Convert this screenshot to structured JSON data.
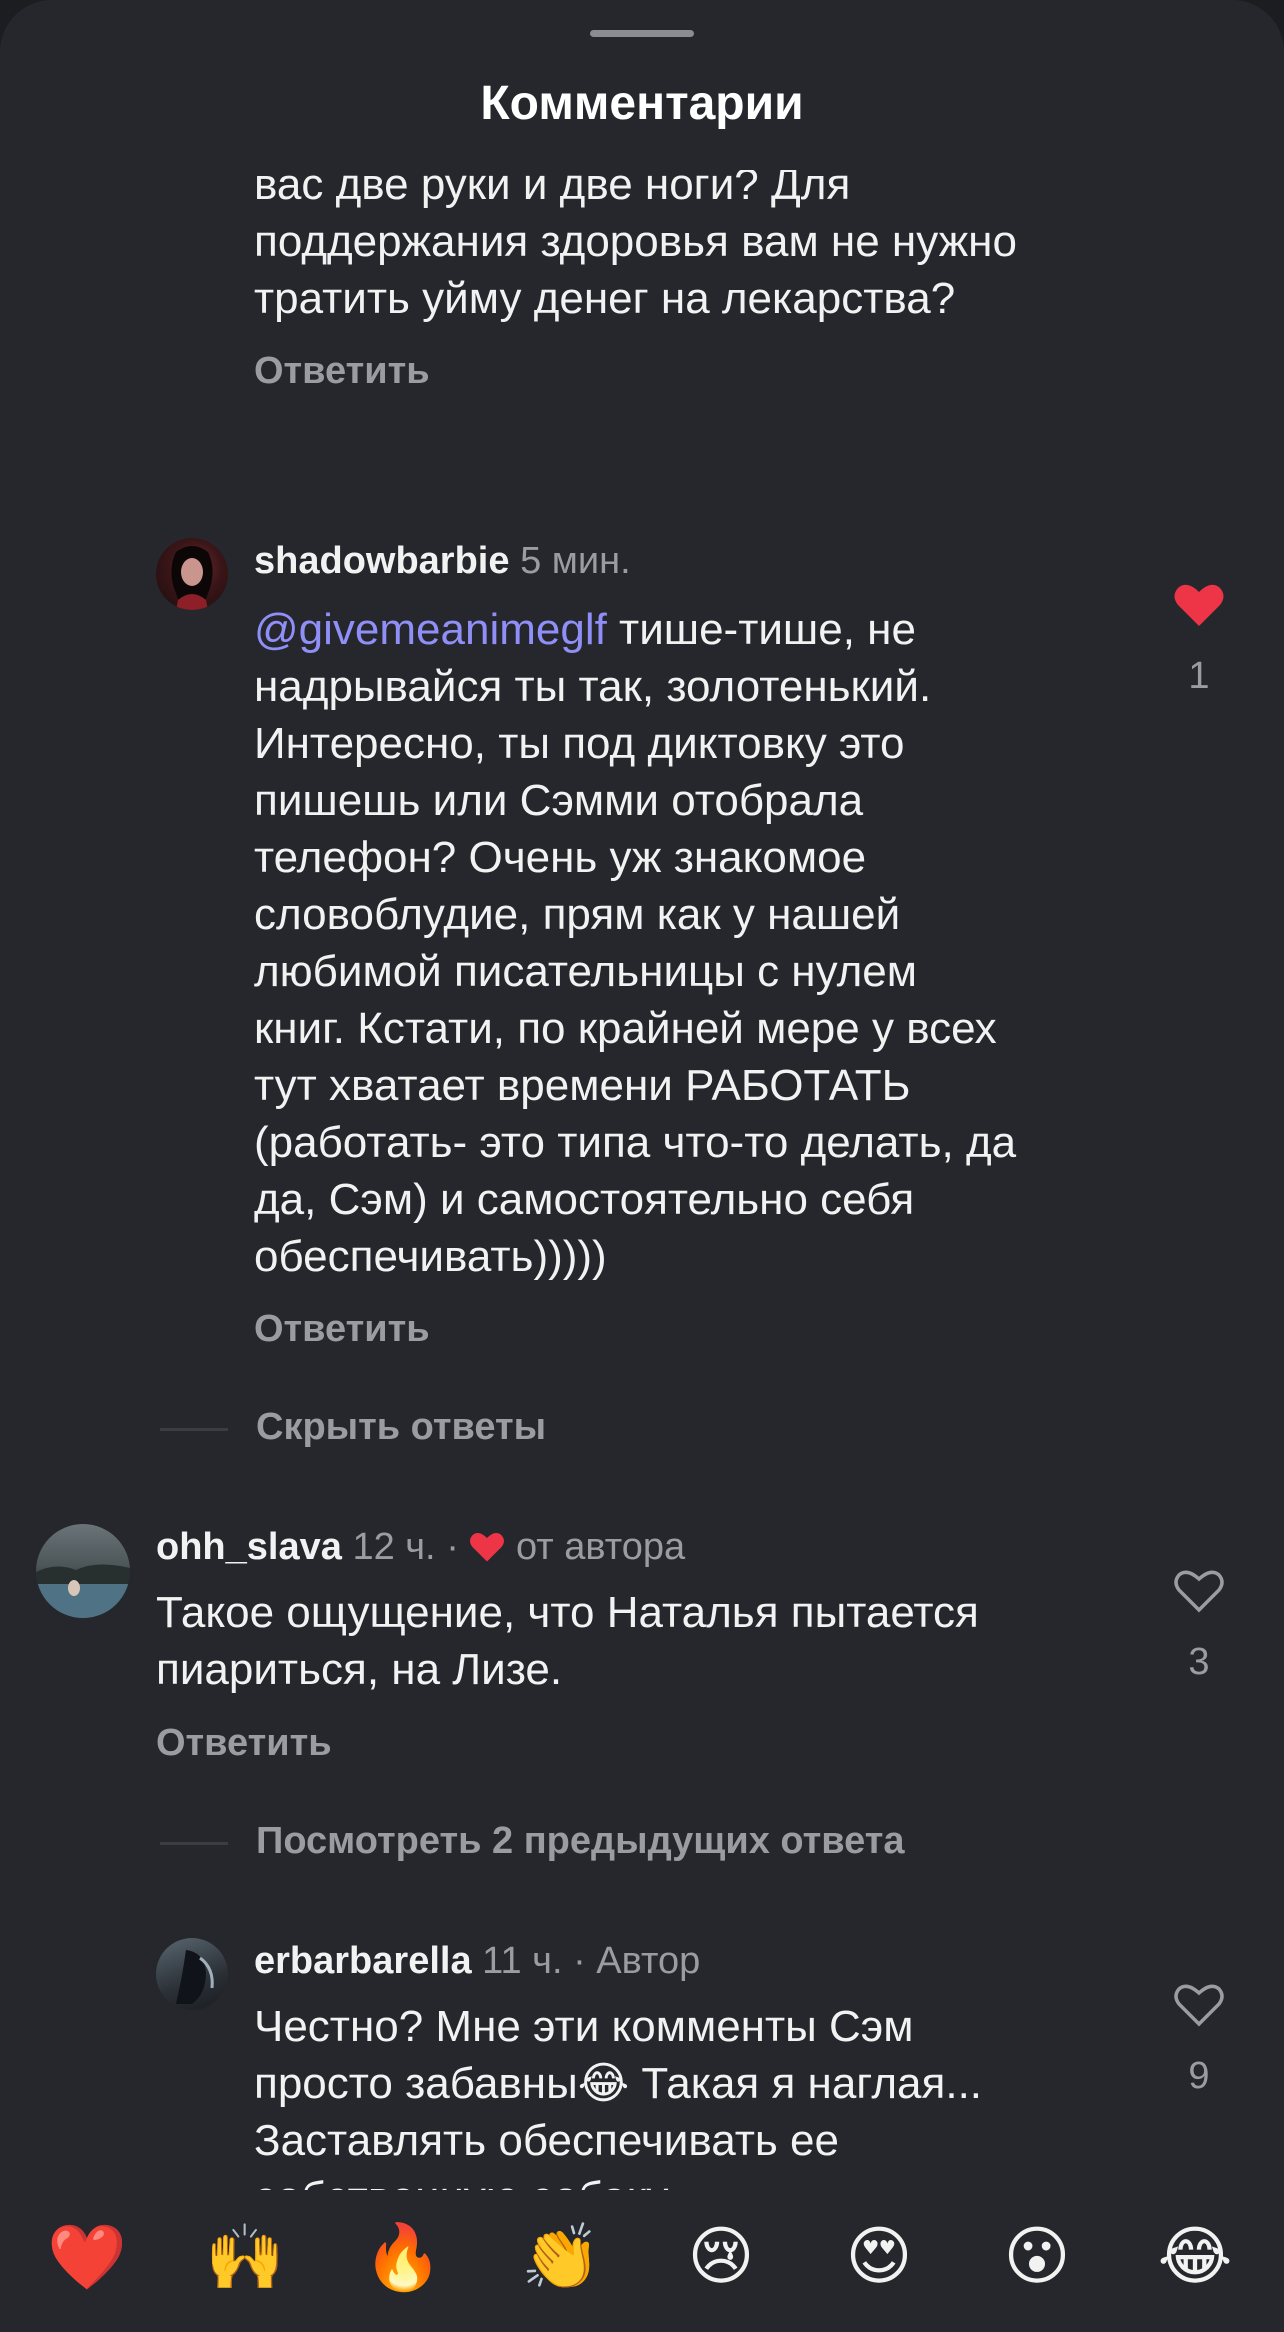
{
  "header": {
    "title": "Комментарии"
  },
  "top_comment": {
    "lines": [
      "вас две руки и две ноги? Для",
      "поддержания здоровья вам не нужно",
      "тратить уйму денег на лекарства?"
    ],
    "reply_label": "Ответить"
  },
  "reply1": {
    "username": "shadowbarbie",
    "time": "5 мин.",
    "mention": "@givemeanimeglf",
    "lines": [
      " тише-тише, не",
      "надрывайся ты так, золотенький.",
      "Интересно, ты под диктовку это",
      "пишешь или Сэмми отобрала",
      "телефон? Очень уж знакомое",
      "словоблудие, прям как у нашей",
      "любимой писательницы с нулем",
      "книг. Кстати, по крайней мере у всех",
      "тут хватает времени РАБОТАТЬ",
      "(работать- это типа что-то делать, да",
      "да, Сэм) и самостоятельно себя",
      "обеспечивать)))))"
    ],
    "reply_label": "Ответить",
    "like_count": "1",
    "liked": true
  },
  "hide_replies_label": "Скрыть ответы",
  "comment2": {
    "username": "ohh_slava",
    "time": "12 ч.",
    "separator": "·",
    "author_like_label": "от автора",
    "lines": [
      "Такое ощущение, что Наталья пытается",
      "пиариться, на Лизе."
    ],
    "reply_label": "Ответить",
    "like_count": "3"
  },
  "view_previous_label": "Посмотреть 2 предыдущих ответа",
  "reply2": {
    "username": "erbarbarella",
    "time": "11 ч.",
    "separator": "·",
    "author_badge": "Автор",
    "lines": [
      "Честно? Мне эти комменты Сэм",
      "просто забавны😂 Такая я наглая...",
      "Заставлять обеспечивать ее",
      "собственную собаку..."
    ],
    "like_count": "9"
  },
  "emoji_bar": {
    "items": [
      "❤️",
      "🙌",
      "🔥",
      "👏",
      "😢",
      "😍",
      "😮",
      "😂"
    ]
  },
  "colors": {
    "background": "#25272c",
    "like_red": "#ed3547",
    "mention": "#8f8ff7",
    "muted": "#9a9ca1"
  }
}
